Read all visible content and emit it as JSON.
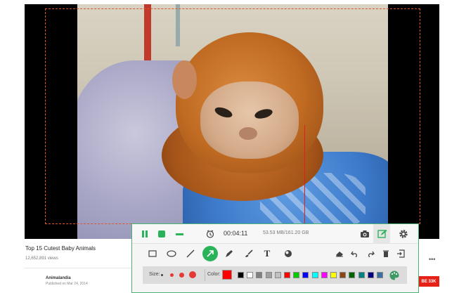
{
  "video": {
    "title": "Top 15 Cutest Baby Animals",
    "views": "12,652,891 views",
    "channel": "Animalandia",
    "published": "Published on Mar 24, 2014",
    "subscribe_label": "BE 33K",
    "more_label": "•••"
  },
  "toolbar": {
    "timer": "00:04:11",
    "storage": "53.53 MB/161.20 GB",
    "size_label": "Size:",
    "color_label": "Color:",
    "current_color": "#ff0000",
    "accent_color": "#2bb35a",
    "swatches": [
      "#000000",
      "#ffffff",
      "#808080",
      "#a0a0a0",
      "#c0c0c0",
      "#ff0000",
      "#00cc00",
      "#0000ff",
      "#00ffff",
      "#ff00ff",
      "#ffff00",
      "#8b4513",
      "#006400",
      "#008080",
      "#000080",
      "#3a6fa0"
    ],
    "draw_tools": [
      "rectangle-icon",
      "ellipse-icon",
      "line-icon",
      "arrow-icon",
      "pencil-icon",
      "brush-icon",
      "text-icon",
      "blur-icon",
      "eraser-icon",
      "undo-icon",
      "redo-icon",
      "trash-icon",
      "exit-icon"
    ]
  }
}
